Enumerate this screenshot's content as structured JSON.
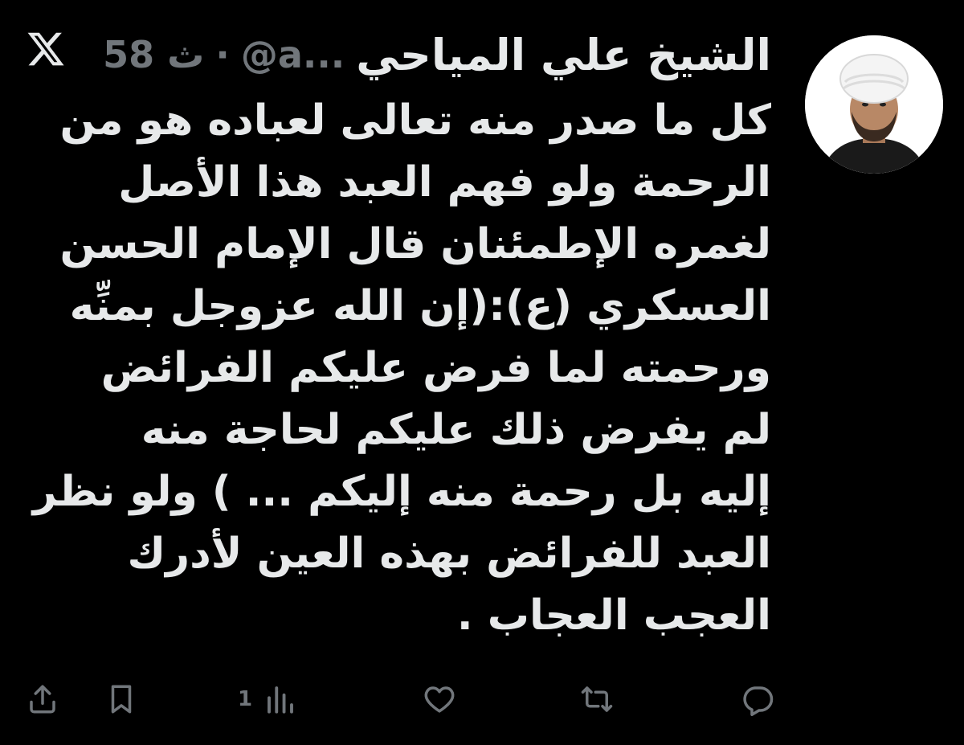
{
  "author": {
    "name": "الشيخ علي المياحي",
    "handle": "@a...",
    "separator": "·",
    "time": "58 ث"
  },
  "tweet": {
    "lines": [
      "كل ما صدر منه تعالى لعباده هو من",
      "الرحمة ولو فهم العبد هذا الأصل",
      "لغمره الإطمئنان قال الإمام الحسن",
      "العسكري (ع):(إن الله عزوجل بمنِّه",
      "ورحمته لما فرض عليكم الفرائض",
      "لم يفرض ذلك عليكم لحاجة منه",
      "إليه بل رحمة منه إليكم ... ) ولو نظر",
      "العبد للفرائض بهذه العين لأدرك",
      "العجب العجاب ."
    ]
  },
  "actions": {
    "views_count": "1"
  },
  "icons": {
    "x_logo": "x-logo-icon",
    "share": "share-icon",
    "bookmark": "bookmark-icon",
    "views": "views-chart-icon",
    "like": "heart-icon",
    "retweet": "retweet-icon",
    "reply": "reply-icon"
  },
  "colors": {
    "background": "#000000",
    "text": "#e7e9ea",
    "muted": "#71767b"
  }
}
